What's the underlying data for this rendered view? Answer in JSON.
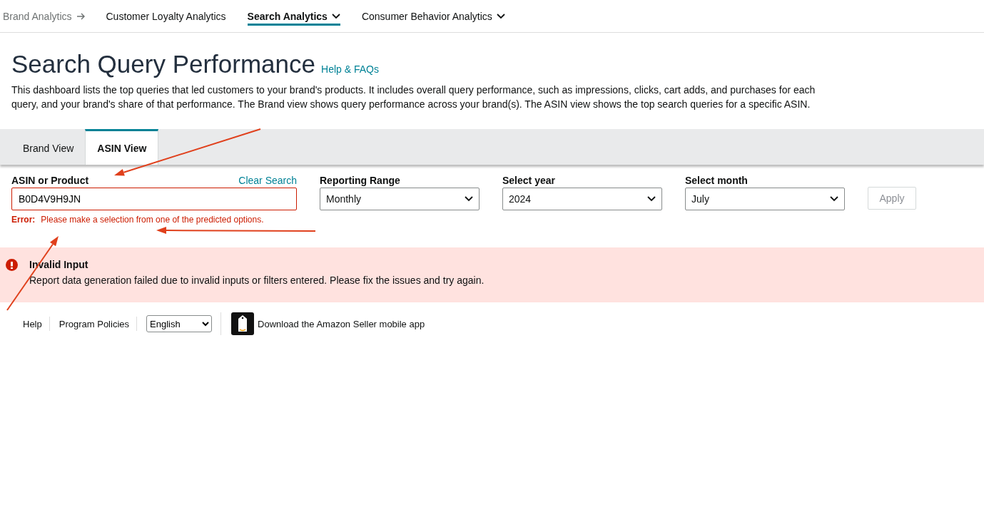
{
  "nav": [
    {
      "label": "Brand Analytics",
      "kind": "parent",
      "selected": false
    },
    {
      "label": "Customer Loyalty Analytics",
      "kind": "link",
      "selected": false
    },
    {
      "label": "Search Analytics",
      "kind": "menu",
      "selected": true
    },
    {
      "label": "Consumer Behavior Analytics",
      "kind": "menu",
      "selected": false
    }
  ],
  "page": {
    "title": "Search Query Performance",
    "help_link": "Help & FAQs",
    "description": "This dashboard lists the top queries that led customers to your brand's products. It includes overall query performance, such as impressions, clicks, cart adds, and purchases for each query, and your brand's share of that performance. The Brand view shows query performance across your brand(s). The ASIN view shows the top search queries for a specific ASIN."
  },
  "tabs": [
    {
      "label": "Brand View",
      "selected": false
    },
    {
      "label": "ASIN View",
      "selected": true
    }
  ],
  "filters": {
    "asin": {
      "label": "ASIN or Product",
      "clear": "Clear Search",
      "value": "B0D4V9H9JN",
      "error_label": "Error:",
      "error": "Please make a selection from one of the predicted options."
    },
    "selects": [
      {
        "label": "Reporting Range",
        "value": "Monthly"
      },
      {
        "label": "Select year",
        "value": "2024"
      },
      {
        "label": "Select month",
        "value": "July"
      }
    ],
    "apply": {
      "label": "Apply",
      "disabled": true
    }
  },
  "alert": {
    "title": "Invalid Input",
    "message": "Report data generation failed due to invalid inputs or filters entered. Please fix the issues and try again."
  },
  "footer": {
    "links": [
      "Help",
      "Program Policies"
    ],
    "language": "English",
    "app_text": "Download the Amazon Seller mobile app"
  }
}
